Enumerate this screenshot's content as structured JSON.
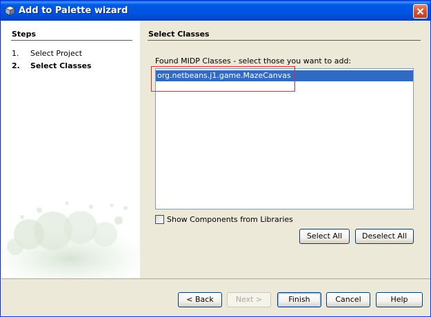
{
  "window": {
    "title": "Add to Palette wizard"
  },
  "steps": {
    "heading": "Steps",
    "items": [
      {
        "number": "1.",
        "label": "Select Project",
        "current": false
      },
      {
        "number": "2.",
        "label": "Select Classes",
        "current": true
      }
    ]
  },
  "content": {
    "heading": "Select Classes",
    "found_label": "Found MIDP Classes - select those you want to add:",
    "classes": [
      {
        "name": "org.netbeans.j1.game.MazeCanvas",
        "selected": true
      }
    ],
    "show_components_label": "Show Components from Libraries",
    "show_components_checked": false,
    "select_all_label": "Select All",
    "deselect_all_label": "Deselect All"
  },
  "footer": {
    "back_label": "< Back",
    "next_label": "Next >",
    "finish_label": "Finish",
    "cancel_label": "Cancel",
    "help_label": "Help"
  },
  "colors": {
    "titlebar": "#0054e3",
    "selection": "#316ac5",
    "annotation": "#e3262b"
  },
  "icons": {
    "title_icon": "cube-icon",
    "close": "close-icon"
  }
}
